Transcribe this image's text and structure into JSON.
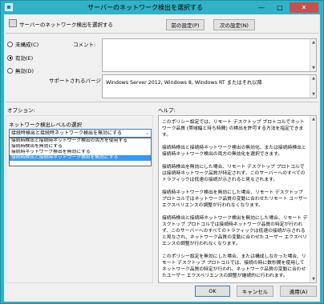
{
  "window": {
    "title": "サーバーのネットワーク検出を選択する",
    "controls": {
      "minimize": "—",
      "maximize": "□",
      "close": "✕"
    }
  },
  "header": {
    "policy_label": "サーバーのネットワーク検出を選択する",
    "prev_button": "前の設定(P)",
    "next_button": "次の設定(N)"
  },
  "state": {
    "options": [
      {
        "label": "未構成(C)",
        "checked": false
      },
      {
        "label": "有効(E)",
        "checked": true
      },
      {
        "label": "無効(D)",
        "checked": false
      }
    ],
    "comment_label": "コメント:",
    "supported_label": "サポートされるバージョン:",
    "supported_value": "Windows Server 2012, Windows 8, Windows RT またはそれ以降"
  },
  "options_section": {
    "title": "オプション:",
    "select_label": "ネットワーク検出レベルの選択",
    "selected_value": "接続時検出と接続時ネットワーク検出を無効にする",
    "dropdown_items": [
      "接続時検出と接続時ネットワーク検出の両方を使用する",
      "接続時検出を無効にする",
      "接続時ネットワーク検出を無効にする",
      "接続時検出と接続時ネットワーク検出を無効にする"
    ],
    "selected_index": 3
  },
  "help_section": {
    "title": "ヘルプ:",
    "paragraphs": [
      "このポリシー設定では、リモート デスクトップ プロトコルでネットワーク品質 (帯域幅と待ち時間) の検出を許可する方法を指定できます。",
      "接続時検出と接続時ネットワーク検出の無効化、または接続時検出と接続時ネットワーク検出の両方の無効化を選択できます。",
      "接続時検出を無効にした場合、リモート デスクトップ プロトコルでは接続時ネットワーク品質が特定されず、このサーバーへのすべてのトラフィックは低速の接続が示されると見なされます。",
      "接続時ネットワーク検出を無効にした場合、リモート デスクトップ プロトコルではネットワーク品質の変動に合わせたリモート ユーザー エクスペリエンスの調整が行われなくなります。",
      "接続時検出と接続時ネットワーク検出を無効にした場合、リモート デスクトップ プロトコルでは接続時ネットワーク品質の特定が行われず、このサーバーへのすべてのトラフィックは低速の接続が示されると見なされ、ネットワーク品質の変動に合わせたユーザー エクスペリエンスの調整が行われなくなります。",
      "このポリシー設定を無効にした場合、または構成しなかった場合、リモート デスクトップ プロトコルでは、接続の時に数秒間を使用してネットワーク品質の特定が行われ、ネットワーク品質の変動に合わせたユーザー エクスペリエンスの調整が継続的に行われます。"
    ]
  },
  "footer": {
    "ok": "OK",
    "cancel": "キャンセル",
    "apply": "適用(A)"
  }
}
